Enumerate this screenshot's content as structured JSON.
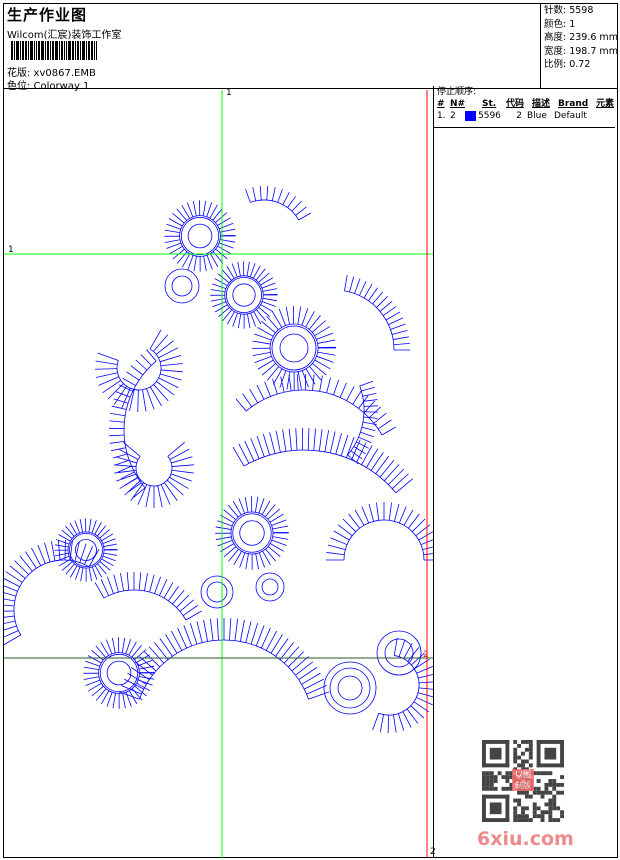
{
  "header": {
    "title": "生产作业图",
    "company": "Wilcom(汇宸)装饰工作室",
    "file_line": "花版: xv0867.EMB",
    "colorway_line": "色位: Colorway 1"
  },
  "info": {
    "stitches": "针数: 5598",
    "colors": "颜色: 1",
    "height": "高度: 239.6 mm",
    "width": "宽度: 198.7 mm",
    "scale": "比例: 0.72"
  },
  "stop_order": {
    "title": "停止顺序:",
    "headers": [
      "#",
      "N#",
      "St.",
      "代码",
      "描述",
      "Brand",
      "元素"
    ],
    "rows": [
      {
        "num": "1.",
        "n": "2",
        "color": "#0000ff",
        "st": "5596",
        "code": "2",
        "desc": "Blue",
        "brand": "Default"
      }
    ]
  },
  "guides": {
    "v1": "1",
    "h1": "1",
    "v2": "2",
    "h2": "2"
  },
  "watermark": {
    "site": "6xiu.com",
    "stamp": "以图制版"
  },
  "colors": {
    "thread": "#0000ff",
    "guide_green": "#00ff00",
    "guide_red": "#ff0000"
  }
}
